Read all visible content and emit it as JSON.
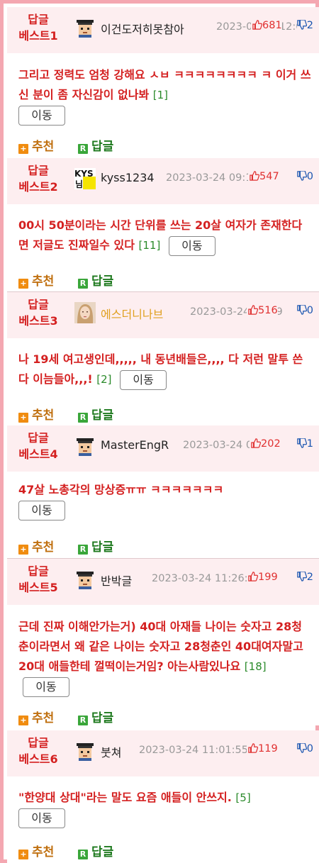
{
  "labels": {
    "move": "이동",
    "recommend": "추천",
    "reply": "답글"
  },
  "colors": {
    "rank": "#d42020",
    "border": "#f4a7b1",
    "header_bg": "#fdeef0",
    "up": "#e03030",
    "down": "#1a55b0"
  },
  "posts": [
    {
      "rank_line1": "답글",
      "rank_line2": "베스트1",
      "avatar": "pixel-man-avatar",
      "nickname": "이건도저히못참아",
      "datetime": "2023-03-24 12:04",
      "up": "681",
      "down": "2",
      "text": "그리고 정력도 엄청 강해요 ㅅㅂ ㅋㅋㅋㅋㅋㅋㅋㅋ ㅋ 이거 쓰신 분이 좀 자신감이 없나봐",
      "replies": "[1]"
    },
    {
      "rank_line1": "답글",
      "rank_line2": "베스트2",
      "avatar": "kys-logo-avatar",
      "nickname": "kyss1234",
      "datetime": "2023-03-24 09:15",
      "up": "547",
      "down": "0",
      "text": "00시 50분이라는 시간 단위를 쓰는 20살 여자가 존재한다면 저글도 진짜일수 있다",
      "replies": "[11]"
    },
    {
      "rank_line1": "답글",
      "rank_line2": "베스트3",
      "avatar": "woman-portrait-avatar",
      "nickname": "에스더니나브",
      "datetime": "2023-03-24 09:49",
      "up": "516",
      "down": "0",
      "text": "나 19세 여고생인데,,,,, 내 동년배들은,,,, 다 저런 말투 쓴다 이늠들아,,,!",
      "replies": "[2]"
    },
    {
      "rank_line1": "답글",
      "rank_line2": "베스트4",
      "avatar": "pixel-man-avatar",
      "nickname": "MasterEngR",
      "datetime": "2023-03-24 09:24",
      "up": "202",
      "down": "1",
      "text": "47살 노총각의 망상증ㅠㅠ ㅋㅋㅋㅋㅋㅋㅋ",
      "replies": ""
    },
    {
      "rank_line1": "답글",
      "rank_line2": "베스트5",
      "avatar": "pixel-man-avatar",
      "nickname": "반박글",
      "datetime": "2023-03-24 11:26:17",
      "up": "199",
      "down": "2",
      "text": "근데 진짜 이해안가는거) 40대 아재들 나이는 숫자고 28청춘이라면서 왜 같은 나이는 숫자고 28청춘인 40대여자말고 20대 애들한테 껄떡이는거임? 아는사람있나요",
      "replies": "[18]"
    },
    {
      "rank_line1": "답글",
      "rank_line2": "베스트6",
      "avatar": "pixel-man-avatar",
      "nickname": "붓쳐",
      "datetime": "2023-03-24 11:01:55",
      "up": "119",
      "down": "0",
      "text": "\"한양대 상대\"라는 말도 요즘 애들이 안쓰지.",
      "replies": "[5]"
    }
  ]
}
